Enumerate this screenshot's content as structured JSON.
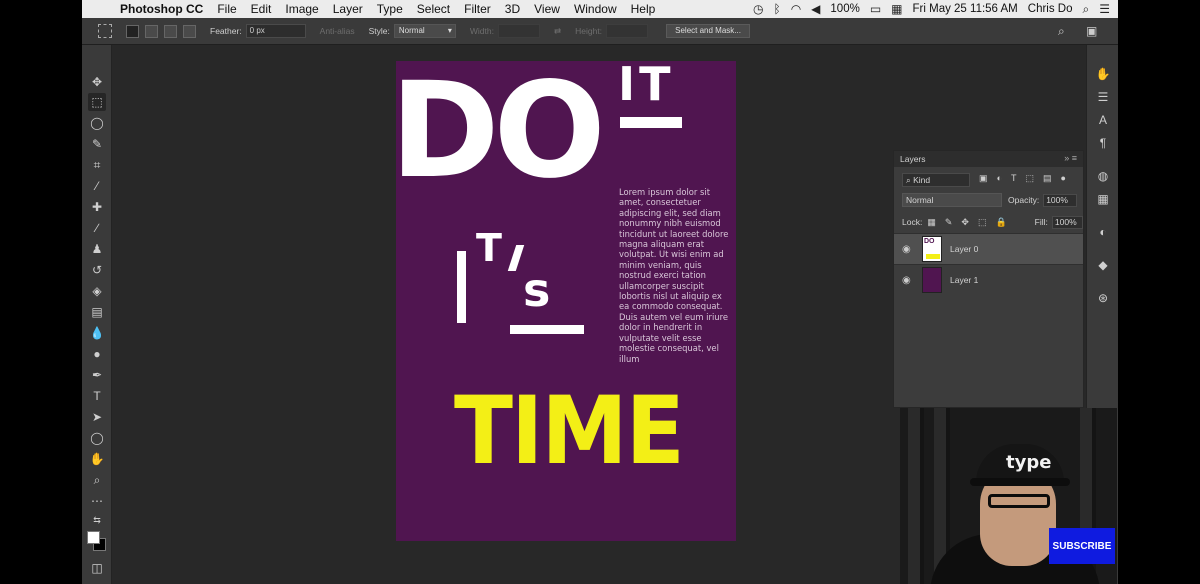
{
  "menubar": {
    "app_name": "Photoshop CC",
    "items": [
      "File",
      "Edit",
      "Image",
      "Layer",
      "Type",
      "Select",
      "Filter",
      "3D",
      "View",
      "Window",
      "Help"
    ],
    "battery": "100%",
    "datetime": "Fri May 25  11:56 AM",
    "user": "Chris Do"
  },
  "options_bar": {
    "feather_label": "Feather:",
    "feather_value": "0 px",
    "anti_alias_label": "Anti-alias",
    "style_label": "Style:",
    "style_value": "Normal",
    "width_label": "Width:",
    "height_label": "Height:",
    "select_mask_label": "Select and Mask..."
  },
  "document": {
    "big_word": "DO",
    "small_word": "IT",
    "its_t": "T",
    "its_s": "s",
    "body_text": "Lorem ipsum dolor sit amet, consectetuer adipiscing elit, sed diam nonummy nibh euismod tincidunt ut laoreet dolore magna aliquam erat volutpat. Ut wisi enim ad minim veniam, quis nostrud exerci tation ullamcorper suscipit lobortis nisl ut aliquip ex ea commodo consequat. Duis autem vel eum iriure dolor in hendrerit in vulputate velit esse molestie consequat, vel illum",
    "time_word": "TIME",
    "bg_color": "#501550",
    "accent_color": "#f3ef16"
  },
  "layers_panel": {
    "title": "Layers",
    "kind_filter": "Kind",
    "blend_mode": "Normal",
    "opacity_label": "Opacity:",
    "opacity_value": "100%",
    "lock_label": "Lock:",
    "fill_label": "Fill:",
    "fill_value": "100%",
    "layers": [
      {
        "name": "Layer 0",
        "thumb_text": "DO"
      },
      {
        "name": "Layer 1"
      }
    ]
  },
  "webcam": {
    "cap_text": "type",
    "subscribe_label": "SUBSCRIBE"
  }
}
